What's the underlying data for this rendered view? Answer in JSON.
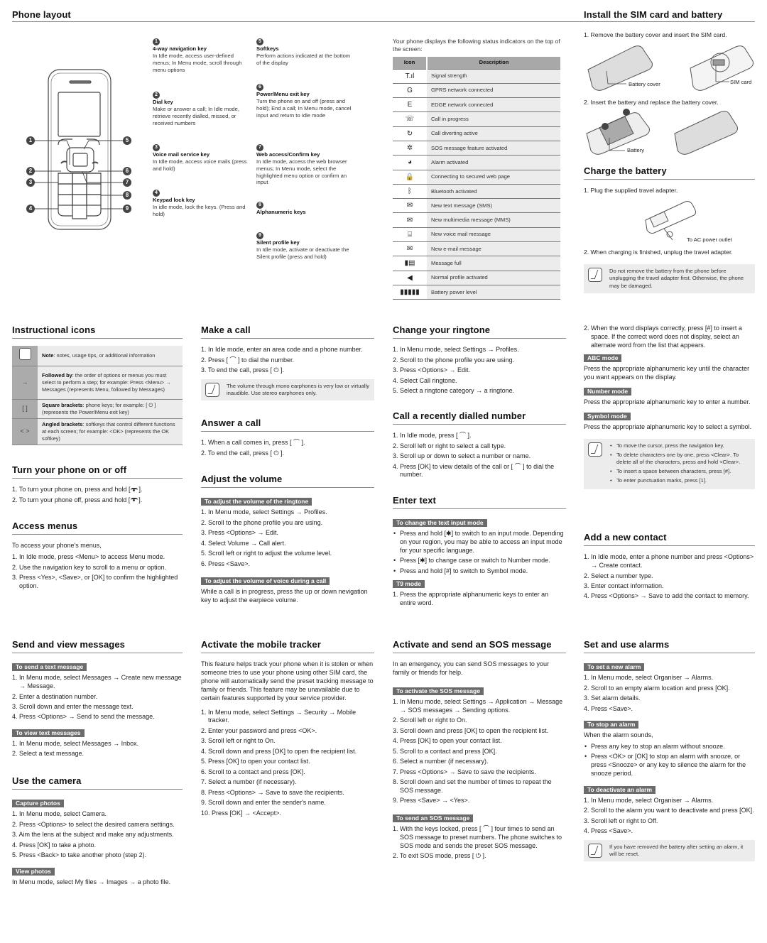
{
  "phone_layout": {
    "title": "Phone layout",
    "callout_numbers": [
      "1",
      "2",
      "3",
      "4",
      "5",
      "6",
      "7",
      "8",
      "9"
    ],
    "keys": [
      {
        "num": "1",
        "title": "4-way navigation key",
        "desc": "In Idle mode, access user-defined menus; In Menu mode, scroll through menu options"
      },
      {
        "num": "2",
        "title": "Dial key",
        "desc": "Make or answer a call; In Idle mode, retrieve recently dialled, missed, or received numbers"
      },
      {
        "num": "3",
        "title": "Voice mail service key",
        "desc": "In Idle mode, access voice mails (press and hold)"
      },
      {
        "num": "4",
        "title": "Keypad lock key",
        "desc": "In idle mode, lock the keys. (Press and hold)"
      },
      {
        "num": "5",
        "title": "Softkeys",
        "desc": "Perform actions indicated at the bottom of the display"
      },
      {
        "num": "6",
        "title": "Power/Menu exit key",
        "desc": "Turn the phone on and off (press and hold); End a call; In Menu mode, cancel input and return to Idle mode"
      },
      {
        "num": "7",
        "title": "Web access/Confirm key",
        "desc": "In Idle mode, access the web browser menus; In Menu mode, select the highlighted menu option or confirm an input"
      },
      {
        "num": "8",
        "title": "Alphanumeric keys",
        "desc": ""
      },
      {
        "num": "9",
        "title": "Silent profile key",
        "desc": "In Idle mode, activate or deactivate the Silent profile (press and hold)"
      }
    ]
  },
  "status": {
    "intro": "Your phone displays the following status indicators on the top of the screen:",
    "col_icon": "Icon",
    "col_desc": "Description",
    "rows": [
      {
        "icon": "signal-strength-icon",
        "glyph": "T.ıl",
        "desc": "Signal strength"
      },
      {
        "icon": "gprs-icon",
        "glyph": "G",
        "desc": "GPRS network connected"
      },
      {
        "icon": "edge-icon",
        "glyph": "E",
        "desc": "EDGE network connected"
      },
      {
        "icon": "call-in-progress-icon",
        "glyph": "☏",
        "desc": "Call in progress"
      },
      {
        "icon": "call-divert-icon",
        "glyph": "↻",
        "desc": "Call diverting active"
      },
      {
        "icon": "sos-icon",
        "glyph": "✲",
        "desc": "SOS message feature activated"
      },
      {
        "icon": "alarm-icon",
        "glyph": "◕",
        "desc": "Alarm activated"
      },
      {
        "icon": "secure-web-icon",
        "glyph": "🔒",
        "desc": "Connecting to secured web page"
      },
      {
        "icon": "bluetooth-icon",
        "glyph": "ᛒ",
        "desc": "Bluetooth activated"
      },
      {
        "icon": "sms-icon",
        "glyph": "✉",
        "desc": "New text message (SMS)"
      },
      {
        "icon": "mms-icon",
        "glyph": "✉",
        "desc": "New multimedia message (MMS)"
      },
      {
        "icon": "voicemail-icon",
        "glyph": "⌸",
        "desc": "New voice mail message"
      },
      {
        "icon": "email-icon",
        "glyph": "✉",
        "desc": "New e-mail message"
      },
      {
        "icon": "message-full-icon",
        "glyph": "▮▤",
        "desc": "Message full"
      },
      {
        "icon": "speaker-icon",
        "glyph": "◀",
        "desc": "Normal profile activated"
      },
      {
        "icon": "battery-icon",
        "glyph": "▮▮▮▮▮",
        "desc": "Battery power level"
      }
    ]
  },
  "install": {
    "title": "Install the SIM card and battery",
    "step1": "1. Remove the battery cover and insert the SIM card.",
    "label_cover": "Battery cover",
    "label_sim": "SIM card",
    "step2": "2. Insert the battery and replace the battery cover.",
    "label_battery": "Battery"
  },
  "charge": {
    "title": "Charge the battery",
    "step1": "1. Plug the supplied travel adapter.",
    "label_ac": "To AC power outlet",
    "step2": "2. When charging is finished, unplug the travel adapter.",
    "note": "Do not remove the battery from the phone before unplugging the travel adapter first. Otherwise, the phone may be damaged."
  },
  "instructional": {
    "title": "Instructional icons",
    "rows": [
      {
        "symbol": "",
        "bold": "Note",
        "text": ": notes, usage tips, or additional information"
      },
      {
        "symbol": "→",
        "bold": "Followed by",
        "text": ": the order of options or menus you must select to perform a step; for example: Press <Menu> → Messages (represents Menu, followed by Messages)"
      },
      {
        "symbol": "[   ]",
        "bold": "Square brackets",
        "text": ": phone keys; for example: [ ⏻ ] (represents the Power/Menu exit key)"
      },
      {
        "symbol": "<   >",
        "bold": "Angled brackets",
        "text": ": softkeys that control different functions at each screen; for example: <OK> (represents the OK softkey)"
      }
    ]
  },
  "turn_on": {
    "title": "Turn your phone on or off",
    "steps": [
      "1. To turn your phone on, press and hold [",
      "2. To turn your phone off, press and hold ["
    ]
  },
  "access_menus": {
    "title": "Access menus",
    "intro": "To access your phone's menus,",
    "steps": [
      "1. In Idle mode, press <Menu> to access Menu mode.",
      "2. Use the navigation key to scroll to a menu or option.",
      "3. Press <Yes>, <Save>, or [OK] to confirm the highlighted option."
    ]
  },
  "make_call": {
    "title": "Make a call",
    "steps": [
      "1. In Idle mode, enter an area code and a phone number.",
      "2. Press [ ⌒ ] to dial the number.",
      "3. To end the call, press [ ⏻ ]."
    ],
    "note": "The volume through mono earphones is very low or virtually inaudible. Use stereo earphones only."
  },
  "answer_call": {
    "title": "Answer a call",
    "steps": [
      "1. When a call comes in, press [ ⌒ ].",
      "2. To end the call, press [ ⏻ ]."
    ]
  },
  "adjust_volume": {
    "title": "Adjust the volume",
    "sub1": "To adjust the volume of the ringtone",
    "steps": [
      "1. In Menu mode, select Settings → Profiles.",
      "2. Scroll to the phone profile you are using.",
      "3. Press <Options> → Edit.",
      "4. Select Volume → Call alert.",
      "5. Scroll left or right to adjust the volume level.",
      "6. Press <Save>."
    ],
    "sub2": "To adjust the volume of voice during a call",
    "voice_text": "While a call is in progress, press the up or down nevigation key to adjust the earpiece volume."
  },
  "ringtone": {
    "title": "Change your ringtone",
    "steps": [
      "1. In Menu mode, select Settings → Profiles.",
      "2. Scroll to the phone profile you are using.",
      "3. Press <Options> → Edit.",
      "4. Select Call ringtone.",
      "5. Select a ringtone category → a ringtone."
    ]
  },
  "recent_call": {
    "title": "Call a recently dialled number",
    "steps": [
      "1. In Idle mode, press [ ⌒ ].",
      "2. Scroll left or right to select a call type.",
      "3. Scroll up or down to select a number or name.",
      "4. Press [OK] to view details of the call or [ ⌒ ] to dial the number."
    ]
  },
  "enter_text": {
    "title": "Enter text",
    "sub1": "To change the text input mode",
    "bullets": [
      "Press and hold [✱] to switch to an input mode. Depending on your region, you may be able to access an input mode for your specific language.",
      "Press [✱] to change case or switch to Number mode.",
      "Press and hold [#] to switch to Symbol mode."
    ],
    "sub2": "T9 mode",
    "t9_steps": [
      "1. Press the appropriate alphanumeric keys to enter an entire word.",
      "2. When the word displays correctly, press [#] to insert a space. If the correct word does not display, select an alternate word from the list that appears."
    ],
    "abc_title": "ABC mode",
    "abc_text": "Press the appropriate alphanumeric key until the character you want appears on the display.",
    "num_title": "Number mode",
    "num_text": "Press the appropriate alphanumeric key to enter a number.",
    "sym_title": "Symbol mode",
    "sym_text": "Press the appropriate alphanumeric key to select a symbol.",
    "note_items": [
      "To move the cursor, press the navigation key.",
      "To delete characters one by one, press <Clear>. To delete all of the characters, press and hold <Clear>.",
      "To insert a space between characters, press [#].",
      "To enter punctuation marks, press [1]."
    ]
  },
  "add_contact": {
    "title": "Add a new contact",
    "steps": [
      "1. In Idle mode, enter a phone number and press <Options> → Create contact.",
      "2. Select a number type.",
      "3. Enter contact information.",
      "4. Press <Options> → Save to add the contact to memory."
    ]
  },
  "messages": {
    "title": "Send and view messages",
    "sub1": "To send a text message",
    "send_steps": [
      "1. In Menu mode, select Messages → Create new message → Message.",
      "2. Enter a destination number.",
      "3. Scroll down and enter the message text.",
      "4. Press <Options> → Send to send the message."
    ],
    "sub2": "To view text messages",
    "view_steps": [
      "1. In Menu mode, select Messages → Inbox.",
      "2. Select a text message."
    ]
  },
  "camera": {
    "title": "Use the camera",
    "sub1": "Capture photos",
    "steps": [
      "1. In Menu mode, select Camera.",
      "2. Press <Options> to select the desired camera settings.",
      "3. Aim the lens at the subject and make any adjustments.",
      "4. Press [OK] to take a photo.",
      "5. Press <Back> to take another photo (step 2)."
    ],
    "sub2": "View photos",
    "view_text": "In Menu mode, select My files → Images → a photo file."
  },
  "tracker": {
    "title": "Activate the mobile tracker",
    "intro": "This feature helps track your phone when it is stolen or when someone tries to use your phone using other SIM card, the phone will automatically send the preset tracking message to family or friends. This feature may be unavailable due to certain features supported by your service provider.",
    "steps": [
      "1. In Menu mode, select Settings → Security → Mobile tracker.",
      "2. Enter your password and press <OK>.",
      "3. Scroll left or right to On.",
      "4. Scroll down and press [OK] to open the recipient list.",
      "5. Press [OK] to open your contact list.",
      "6. Scroll to a contact and press [OK].",
      "7. Select a number (if necessary).",
      "8. Press <Options> → Save to save the recipients.",
      "9. Scroll down and enter the sender's name.",
      "10. Press [OK] → <Accept>."
    ]
  },
  "sos": {
    "title": "Activate and send an SOS message",
    "intro": "In an emergency, you can send SOS messages to your family or friends for help.",
    "sub1": "To activate the SOS message",
    "activate_steps": [
      "1. In Menu mode, select Settings → Application → Message → SOS messages → Sending options.",
      "2. Scroll left or right to On.",
      "3. Scroll down and press [OK] to open the recipient list.",
      "4. Press [OK] to open your contact list.",
      "5. Scroll to a contact and press [OK].",
      "6. Select a number (if necessary).",
      "7. Press <Options> → Save to save the recipients.",
      "8. Scroll down and set the number of times to repeat the SOS message.",
      "9. Press <Save> → <Yes>."
    ],
    "sub2": "To send an SOS message",
    "send_steps": [
      "1. With the keys locked, press [ ⌒ ] four times to send an SOS message to preset numbers. The phone switches to SOS mode and sends the preset SOS message.",
      "2. To exit SOS mode, press [ ⏻ ]."
    ]
  },
  "alarms": {
    "title": "Set and use alarms",
    "sub1": "To set a new alarm",
    "set_steps": [
      "1. In Menu mode, select Organiser → Alarms.",
      "2. Scroll to an empty alarm location and press [OK].",
      "3. Set alarm details.",
      "4. Press <Save>."
    ],
    "sub2": "To stop an alarm",
    "stop_intro": "When the alarm sounds,",
    "stop_bullets": [
      "Press any key to stop an alarm without snooze.",
      "Press <OK> or [OK] to stop an alarm with snooze, or press <Snooze> or any key to silence the alarm for the snooze period."
    ],
    "sub3": "To deactivate an alarm",
    "deact_steps": [
      "1. In Menu mode, select Organiser → Alarms.",
      "2. Scroll to the alarm you want to deactivate and press [OK].",
      "3. Scroll left or right to Off.",
      "4. Press <Save>."
    ],
    "note": "If you have removed the battery after setting an alarm, it will be reset."
  }
}
